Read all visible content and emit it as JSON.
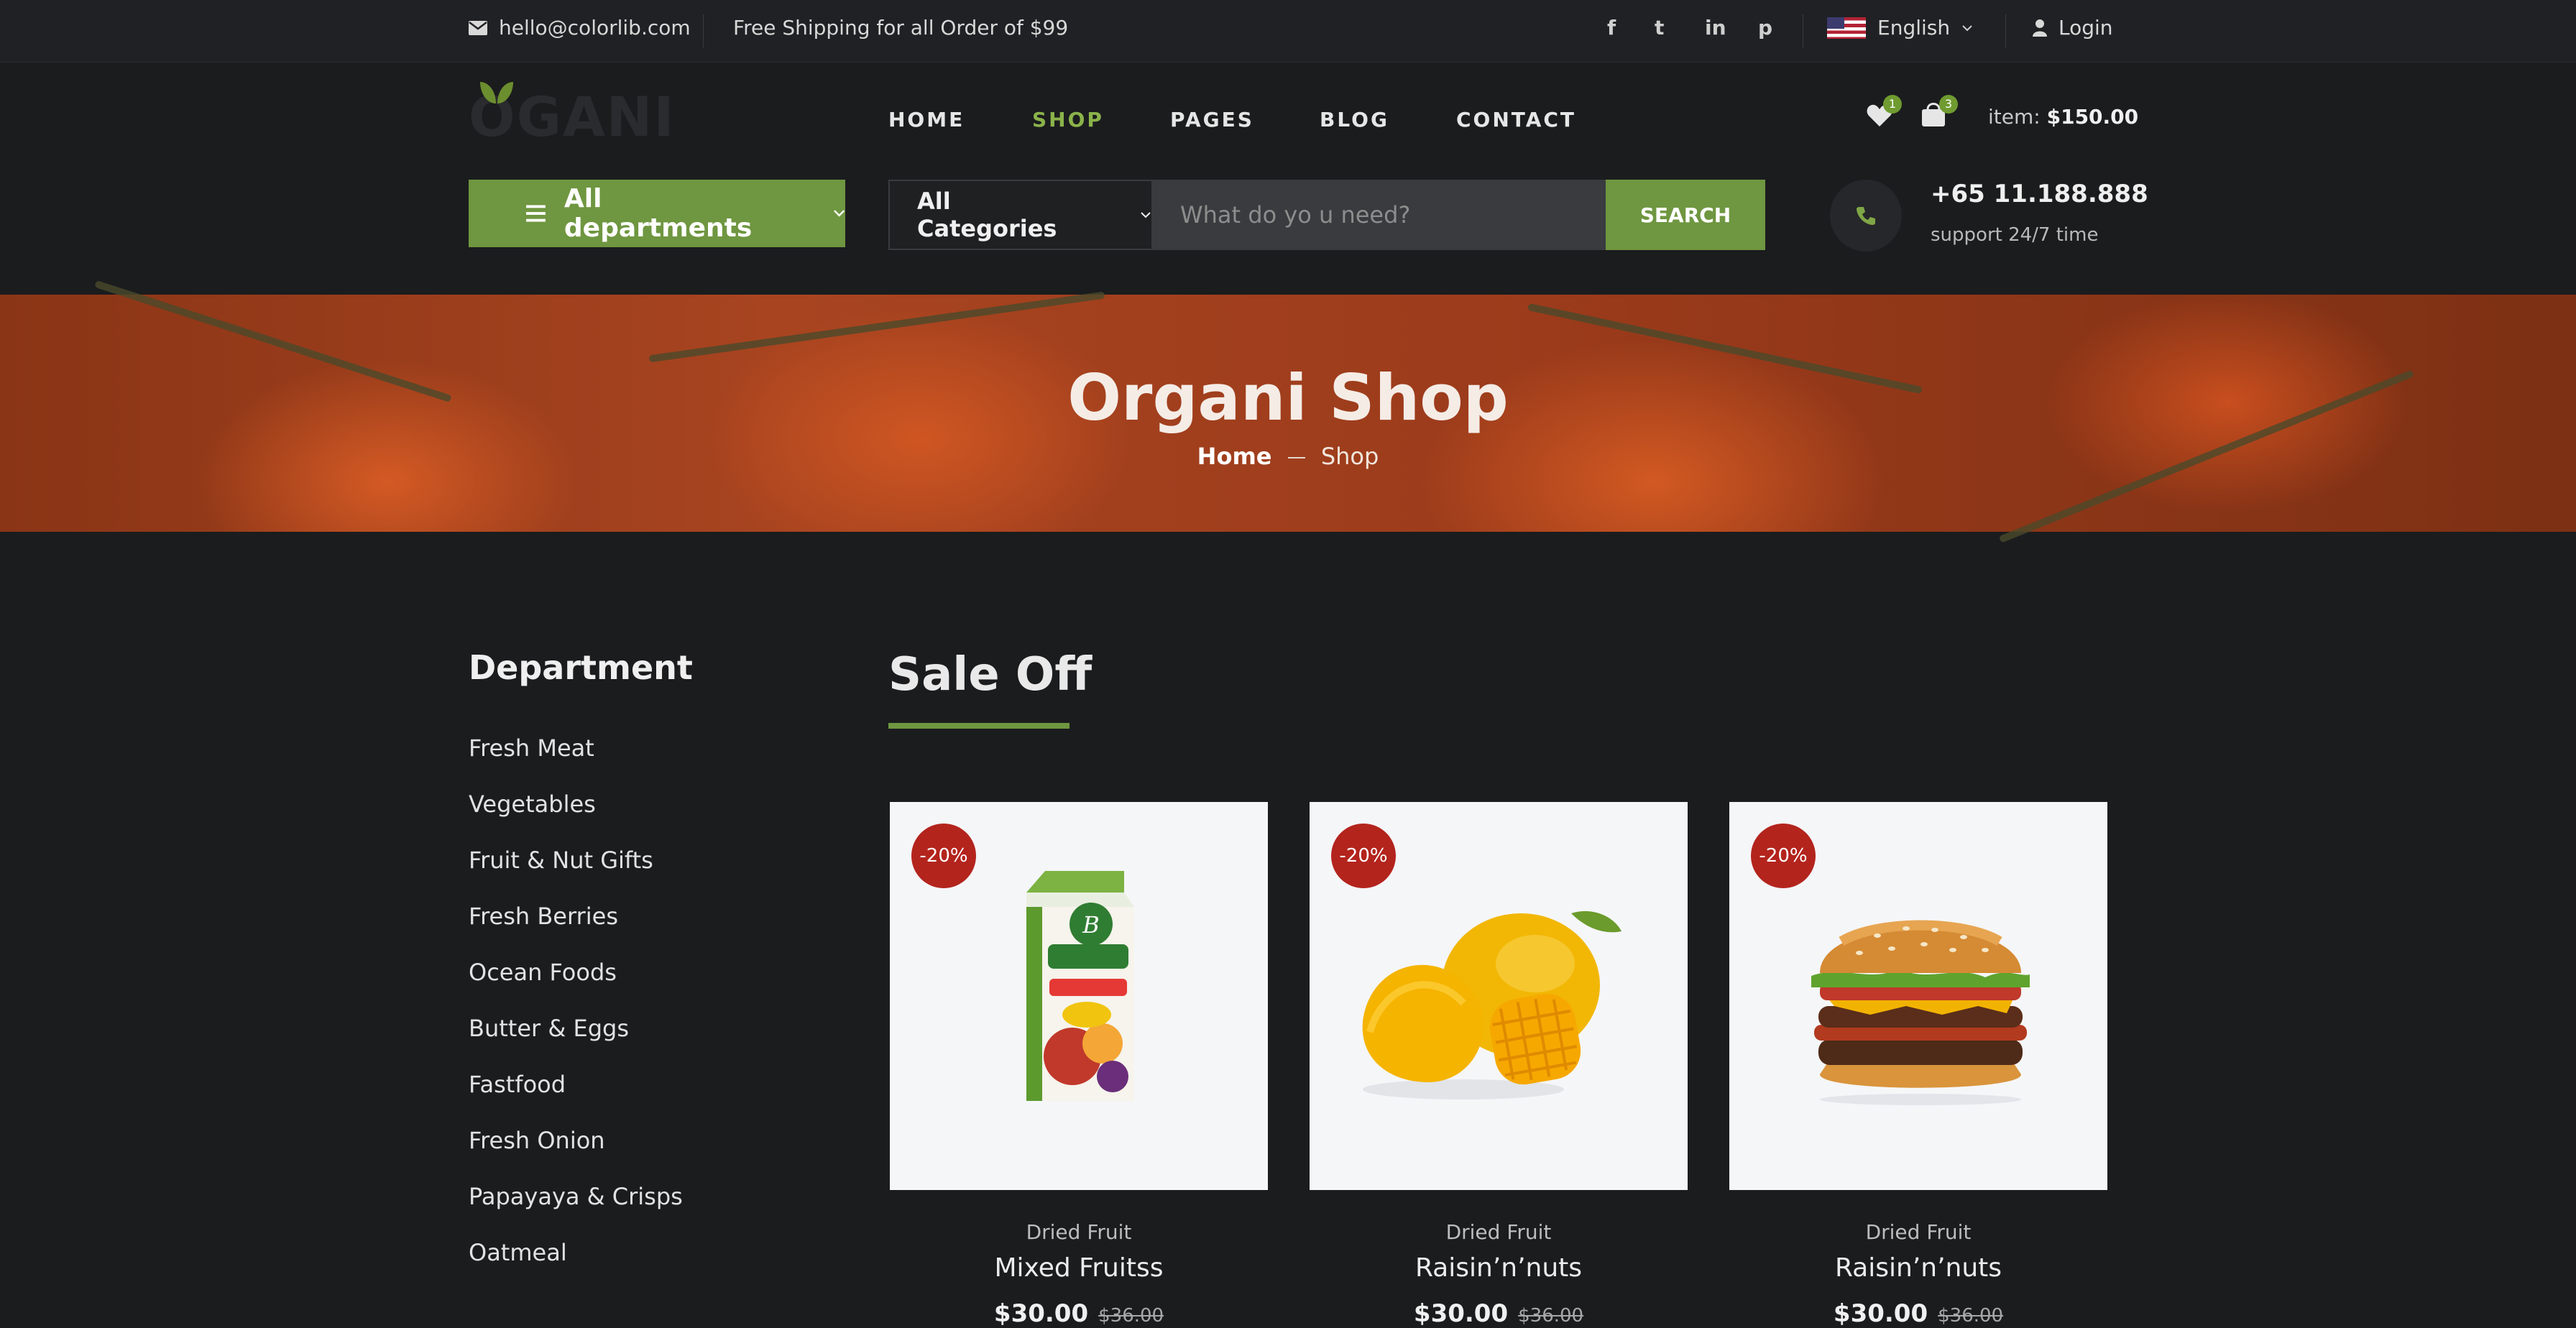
{
  "topbar": {
    "email": "hello@colorlib.com",
    "shipping": "Free Shipping for all Order of $99",
    "social": [
      "f",
      "t",
      "in",
      "p"
    ],
    "language": "English",
    "login": "Login"
  },
  "header": {
    "logo": "OGANI",
    "nav": [
      "HOME",
      "SHOP",
      "PAGES",
      "BLOG",
      "CONTACT"
    ],
    "active_nav": "SHOP",
    "wishlist_count": "1",
    "cart_count": "3",
    "item_label": "item:",
    "item_total": "$150.00"
  },
  "search": {
    "departments_label": "All departments",
    "categories_label": "All Categories",
    "placeholder": "What do yo u need?",
    "button": "SEARCH",
    "phone": "+65 11.188.888",
    "support": "support 24/7 time"
  },
  "hero": {
    "title": "Organi Shop",
    "breadcrumb_home": "Home",
    "breadcrumb_current": "Shop"
  },
  "sidebar": {
    "title": "Department",
    "items": [
      "Fresh Meat",
      "Vegetables",
      "Fruit & Nut Gifts",
      "Fresh Berries",
      "Ocean Foods",
      "Butter & Eggs",
      "Fastfood",
      "Fresh Onion",
      "Papayaya & Crisps",
      "Oatmeal"
    ]
  },
  "sale": {
    "title": "Sale Off",
    "products": [
      {
        "discount": "-20%",
        "category": "Dried Fruit",
        "name": "Mixed Fruitss",
        "price": "$30.00",
        "old_price": "$36.00",
        "image": "juice-carton"
      },
      {
        "discount": "-20%",
        "category": "Dried Fruit",
        "name": "Raisin’n’nuts",
        "price": "$30.00",
        "old_price": "$36.00",
        "image": "mango"
      },
      {
        "discount": "-20%",
        "category": "Dried Fruit",
        "name": "Raisin’n’nuts",
        "price": "$30.00",
        "old_price": "$36.00",
        "image": "burger"
      }
    ]
  },
  "colors": {
    "accent": "#6f9640",
    "accent_light": "#8bb34a",
    "discount": "#b3241d",
    "background": "#1b1c1e"
  }
}
